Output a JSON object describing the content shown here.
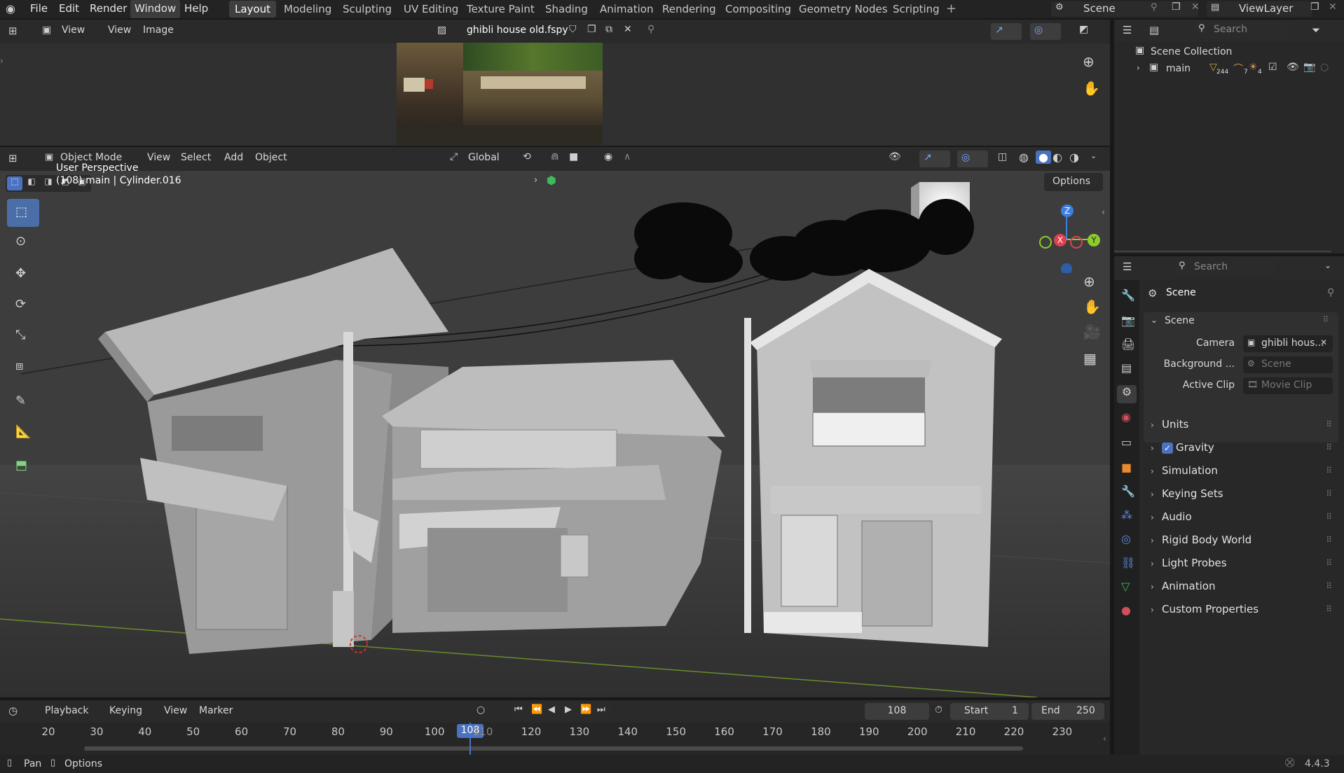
{
  "menus": [
    "File",
    "Edit",
    "Render",
    "Window",
    "Help"
  ],
  "workspaces": [
    "Layout",
    "Modeling",
    "Sculpting",
    "UV Editing",
    "Texture Paint",
    "Shading",
    "Animation",
    "Rendering",
    "Compositing",
    "Geometry Nodes",
    "Scripting"
  ],
  "scene_name": "Scene",
  "viewlayer_name": "ViewLayer",
  "image_editor": {
    "view": "View",
    "view2": "View",
    "image": "Image",
    "filename": "ghibli house old.fspy"
  },
  "outliner": {
    "search_placeholder": "Search",
    "collection": "Scene Collection",
    "item": "main",
    "counts": [
      "244",
      "7",
      "4"
    ]
  },
  "viewport": {
    "mode": "Object Mode",
    "menus": [
      "View",
      "Select",
      "Add",
      "Object"
    ],
    "orientation": "Global",
    "options": "Options",
    "info_line1": "User Perspective",
    "info_line2": "(108) main | Cylinder.016",
    "gizmo": {
      "z": "Z",
      "x": "X",
      "y": "Y"
    }
  },
  "properties": {
    "search_placeholder": "Search",
    "context": "Scene",
    "section": "Scene",
    "camera_label": "Camera",
    "camera_value": "ghibli hous...",
    "background_label": "Background ...",
    "background_value": "Scene",
    "clip_label": "Active Clip",
    "clip_value": "Movie Clip",
    "panels": [
      "Units",
      "Gravity",
      "Simulation",
      "Keying Sets",
      "Audio",
      "Rigid Body World",
      "Light Probes",
      "Animation",
      "Custom Properties"
    ]
  },
  "timeline": {
    "menus": [
      "Playback",
      "Keying",
      "View",
      "Marker"
    ],
    "current_frame": "108",
    "start_label": "Start",
    "start": "1",
    "end_label": "End",
    "end": "250",
    "ticks": [
      "20",
      "30",
      "40",
      "50",
      "60",
      "70",
      "80",
      "90",
      "100",
      "110",
      "120",
      "130",
      "140",
      "150",
      "160",
      "170",
      "180",
      "190",
      "200",
      "210",
      "220",
      "230"
    ]
  },
  "status": {
    "pan": "Pan",
    "options": "Options",
    "version": "4.4.3"
  },
  "colors": {
    "accent": "#4a72c0",
    "x_axis": "#e04050",
    "y_axis": "#8ccc2a",
    "z_axis": "#3d7fe0"
  }
}
